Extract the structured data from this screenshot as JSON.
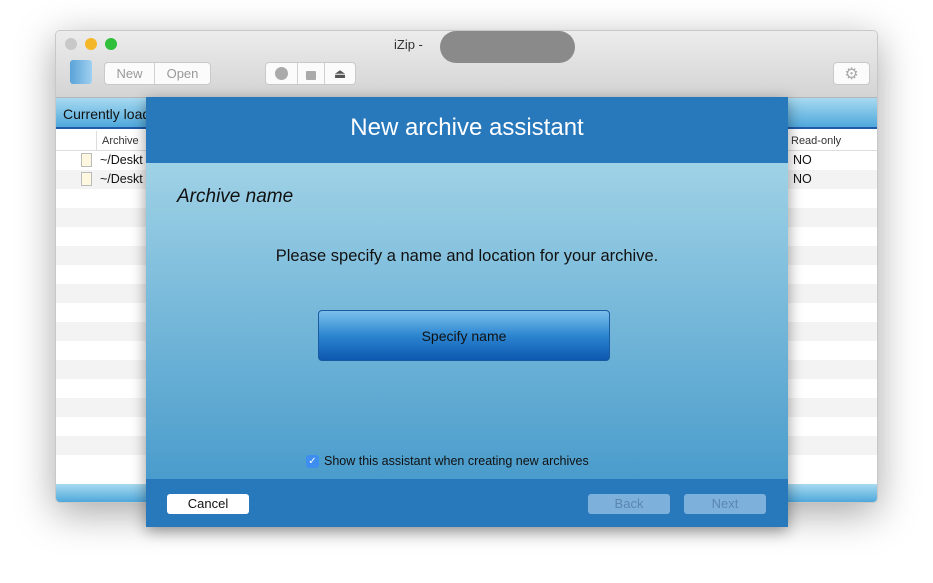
{
  "window": {
    "title": "iZip -",
    "traffic_lights": {
      "close": "#c8c8c8",
      "minimize": "#f5b72a",
      "zoom": "#2fbf3b"
    }
  },
  "toolbar": {
    "new_label": "New",
    "open_label": "Open",
    "icons": [
      "app-folder-icon",
      "search-icon",
      "lock-icon",
      "eject-icon",
      "gear-icon"
    ]
  },
  "table": {
    "section_title": "Currently loaded",
    "columns": {
      "archive": "Archive",
      "read_only": "Read-only"
    },
    "rows": [
      {
        "archive": "~/Deskt",
        "read_only": "NO"
      },
      {
        "archive": "~/Deskt",
        "read_only": "NO"
      }
    ]
  },
  "dialog": {
    "title": "New archive assistant",
    "step_title": "Archive name",
    "instruction": "Please specify a name and location for your archive.",
    "specify_button": "Specify name",
    "checkbox_label": "Show this assistant when creating new archives",
    "checkbox_checked": true,
    "cancel": "Cancel",
    "back": "Back",
    "next": "Next",
    "colors": {
      "header": "#2878bc",
      "button": "#1a64b4"
    }
  }
}
